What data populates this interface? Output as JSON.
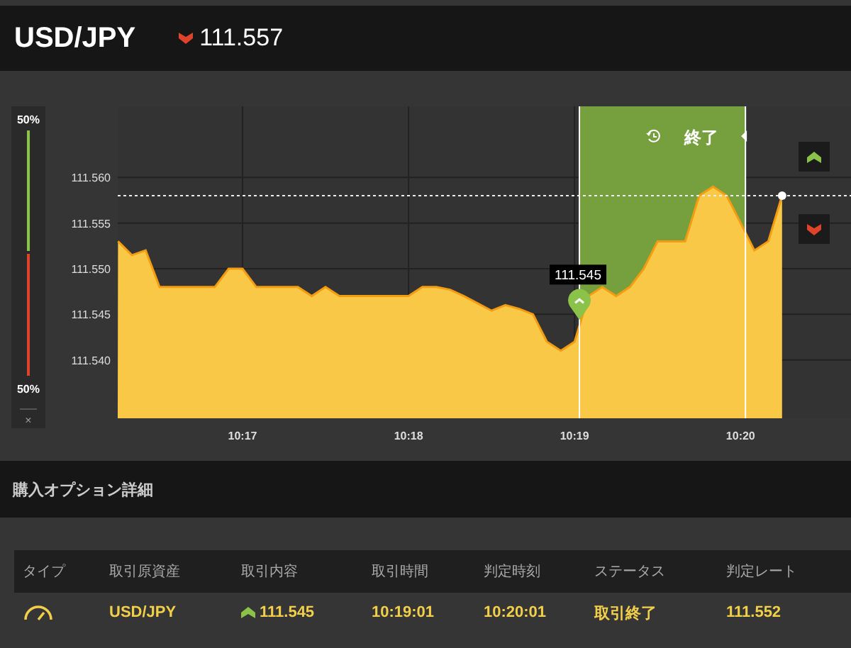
{
  "header": {
    "pair": "USD/JPY",
    "price": "111.557"
  },
  "sentiment": {
    "up_text": "50%",
    "down_text": "50%",
    "level": 0.5,
    "close_label": "×"
  },
  "chart": {
    "chart_data": {
      "type": "area",
      "categories": [
        null,
        null,
        null,
        null,
        null,
        null,
        null,
        null,
        null,
        "10:17",
        null,
        null,
        null,
        null,
        null,
        null,
        null,
        null,
        null,
        null,
        null,
        "10:18",
        null,
        null,
        null,
        null,
        null,
        null,
        null,
        null,
        null,
        null,
        null,
        "10:19",
        null,
        null,
        null,
        null,
        null,
        null,
        null,
        null,
        null,
        null,
        null,
        "10:20",
        null,
        null,
        null
      ],
      "series": [
        {
          "color": "#f9c846",
          "values": [
            111.553,
            111.5515,
            111.552,
            111.548,
            111.548,
            111.548,
            111.548,
            111.548,
            111.55,
            111.55,
            111.548,
            111.548,
            111.548,
            111.548,
            111.547,
            111.548,
            111.547,
            111.547,
            111.547,
            111.547,
            111.547,
            111.547,
            111.548,
            111.548,
            111.5477,
            111.547,
            111.5462,
            111.5454,
            111.546,
            111.5456,
            111.545,
            111.542,
            111.541,
            111.542,
            111.547,
            111.548,
            111.547,
            111.548,
            111.55,
            111.553,
            111.553,
            111.553,
            111.558,
            111.559,
            111.558,
            111.555,
            111.552,
            111.553,
            111.558
          ]
        }
      ],
      "ylim": [
        111.5336,
        111.5678
      ],
      "grid": true,
      "ref_lines": [
        {
          "axis": "y",
          "value": 111.558
        }
      ],
      "annotations": [
        {
          "x": "10:19",
          "y": 111.545,
          "text": "111.545"
        }
      ],
      "yticks": [
        {
          "value": 111.54,
          "label": "111.540"
        },
        {
          "value": 111.545,
          "label": "111.545"
        },
        {
          "value": 111.55,
          "label": "111.550"
        },
        {
          "value": 111.555,
          "label": "111.555"
        },
        {
          "value": 111.56,
          "label": "111.560"
        }
      ]
    },
    "window_label": "終了"
  },
  "trade_buttons": [
    {
      "kind": "up"
    },
    {
      "kind": "down"
    }
  ],
  "section_title": "購入オプション詳細",
  "table": {
    "columns": [
      "タイプ",
      "取引原資産",
      "取引内容",
      "取引時間",
      "判定時刻",
      "ステータス",
      "判定レート"
    ],
    "rows": [
      {
        "asset": "USD/JPY",
        "entry": "111.545",
        "trade_time": "10:19:01",
        "judge_time": "10:20:01",
        "status": "取引終了",
        "rate": "111.552"
      }
    ]
  }
}
